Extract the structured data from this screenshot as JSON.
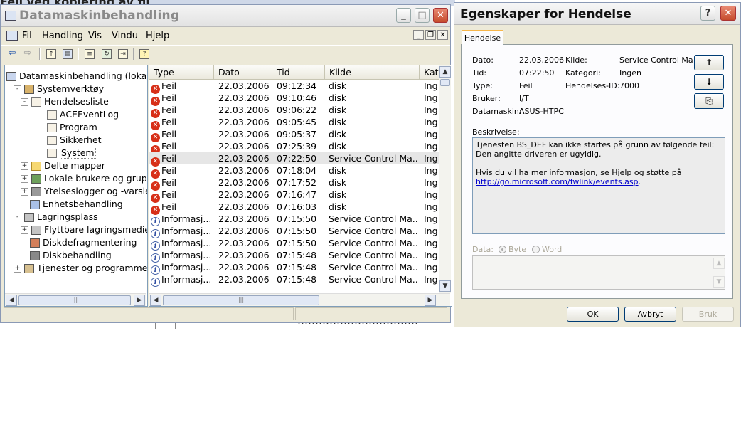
{
  "background": {
    "partial_title": "Feil ved kopiering av fil"
  },
  "mmc": {
    "title": "Datamaskinbehandling",
    "menu": [
      "Fil",
      "Handling",
      "Vis",
      "Vindu",
      "Hjelp"
    ],
    "tree": [
      {
        "label": "Datamaskinbehandling (lokal)",
        "icon": "computer-icon",
        "level": 0,
        "expander": ""
      },
      {
        "label": "Systemverktøy",
        "icon": "tools-icon",
        "level": 1,
        "expander": "-"
      },
      {
        "label": "Hendelsesliste",
        "icon": "event-viewer-icon",
        "level": 2,
        "expander": "-"
      },
      {
        "label": "ACEEventLog",
        "icon": "log-icon",
        "level": 3,
        "expander": ""
      },
      {
        "label": "Program",
        "icon": "log-icon",
        "level": 3,
        "expander": ""
      },
      {
        "label": "Sikkerhet",
        "icon": "log-icon",
        "level": 3,
        "expander": ""
      },
      {
        "label": "System",
        "icon": "log-icon",
        "level": 3,
        "expander": "",
        "selected": true
      },
      {
        "label": "Delte mapper",
        "icon": "shared-folder-icon",
        "level": 2,
        "expander": "+"
      },
      {
        "label": "Lokale brukere og grupp",
        "icon": "users-icon",
        "level": 2,
        "expander": "+"
      },
      {
        "label": "Ytelseslogger og -varsle",
        "icon": "performance-icon",
        "level": 2,
        "expander": "+"
      },
      {
        "label": "Enhetsbehandling",
        "icon": "device-manager-icon",
        "level": 2,
        "expander": ""
      },
      {
        "label": "Lagringsplass",
        "icon": "storage-icon",
        "level": 1,
        "expander": "-"
      },
      {
        "label": "Flyttbare lagringsmedier",
        "icon": "removable-storage-icon",
        "level": 2,
        "expander": "+"
      },
      {
        "label": "Diskdefragmentering",
        "icon": "defrag-icon",
        "level": 2,
        "expander": ""
      },
      {
        "label": "Diskbehandling",
        "icon": "disk-icon",
        "level": 2,
        "expander": ""
      },
      {
        "label": "Tjenester og programmer",
        "icon": "services-icon",
        "level": 1,
        "expander": "+"
      }
    ],
    "columns": [
      "Type",
      "Dato",
      "Tid",
      "Kilde",
      "Kat"
    ],
    "rows": [
      {
        "type": "Feil",
        "kind": "error",
        "date": "22.03.2006",
        "time": "09:12:34",
        "source": "disk",
        "cat": "Ing"
      },
      {
        "type": "Feil",
        "kind": "error",
        "date": "22.03.2006",
        "time": "09:10:46",
        "source": "disk",
        "cat": "Ing"
      },
      {
        "type": "Feil",
        "kind": "error",
        "date": "22.03.2006",
        "time": "09:06:22",
        "source": "disk",
        "cat": "Ing"
      },
      {
        "type": "Feil",
        "kind": "error",
        "date": "22.03.2006",
        "time": "09:05:45",
        "source": "disk",
        "cat": "Ing"
      },
      {
        "type": "Feil",
        "kind": "error",
        "date": "22.03.2006",
        "time": "09:05:37",
        "source": "disk",
        "cat": "Ing"
      },
      {
        "type": "Feil",
        "kind": "error",
        "date": "22.03.2006",
        "time": "07:25:39",
        "source": "disk",
        "cat": "Ing"
      },
      {
        "type": "Feil",
        "kind": "error",
        "date": "22.03.2006",
        "time": "07:22:50",
        "source": "Service Control Ma...",
        "cat": "Ing",
        "selected": true
      },
      {
        "type": "Feil",
        "kind": "error",
        "date": "22.03.2006",
        "time": "07:18:04",
        "source": "disk",
        "cat": "Ing"
      },
      {
        "type": "Feil",
        "kind": "error",
        "date": "22.03.2006",
        "time": "07:17:52",
        "source": "disk",
        "cat": "Ing"
      },
      {
        "type": "Feil",
        "kind": "error",
        "date": "22.03.2006",
        "time": "07:16:47",
        "source": "disk",
        "cat": "Ing"
      },
      {
        "type": "Feil",
        "kind": "error",
        "date": "22.03.2006",
        "time": "07:16:03",
        "source": "disk",
        "cat": "Ing"
      },
      {
        "type": "Informasj...",
        "kind": "info",
        "date": "22.03.2006",
        "time": "07:15:50",
        "source": "Service Control Ma...",
        "cat": "Ing"
      },
      {
        "type": "Informasj...",
        "kind": "info",
        "date": "22.03.2006",
        "time": "07:15:50",
        "source": "Service Control Ma...",
        "cat": "Ing"
      },
      {
        "type": "Informasj...",
        "kind": "info",
        "date": "22.03.2006",
        "time": "07:15:50",
        "source": "Service Control Ma...",
        "cat": "Ing"
      },
      {
        "type": "Informasj...",
        "kind": "info",
        "date": "22.03.2006",
        "time": "07:15:48",
        "source": "Service Control Ma...",
        "cat": "Ing"
      },
      {
        "type": "Informasj...",
        "kind": "info",
        "date": "22.03.2006",
        "time": "07:15:48",
        "source": "Service Control Ma...",
        "cat": "Ing"
      },
      {
        "type": "Informasj...",
        "kind": "info",
        "date": "22.03.2006",
        "time": "07:15:48",
        "source": "Service Control Ma...",
        "cat": "Ing"
      }
    ]
  },
  "dialog": {
    "title": "Egenskaper for Hendelse",
    "tab": "Hendelse",
    "fields": {
      "date_label": "Dato:",
      "date": "22.03.2006",
      "source_label": "Kilde:",
      "source": "Service Control Ma",
      "time_label": "Tid:",
      "time": "07:22:50",
      "category_label": "Kategori:",
      "category": "Ingen",
      "type_label": "Type:",
      "type": "Feil",
      "event_id_label": "Hendelses-ID:",
      "event_id": "7000",
      "user_label": "Bruker:",
      "user": "I/T",
      "computer_label": "Datamaskin:",
      "computer": "ASUS-HTPC"
    },
    "description_label": "Beskrivelse:",
    "description_lines": [
      "Tjenesten BS_DEF kan ikke startes på grunn av følgende feil:",
      "Den angitte driveren er ugyldig.",
      "Hvis du vil ha mer informasjon, se Hjelp og støtte på"
    ],
    "description_link": "http://go.microsoft.com/fwlink/events.asp",
    "description_link_suffix": ".",
    "data_label": "Data:",
    "radio_byte": "Byte",
    "radio_word": "Word",
    "buttons": {
      "ok": "OK",
      "cancel": "Avbryt",
      "apply": "Bruk"
    }
  }
}
